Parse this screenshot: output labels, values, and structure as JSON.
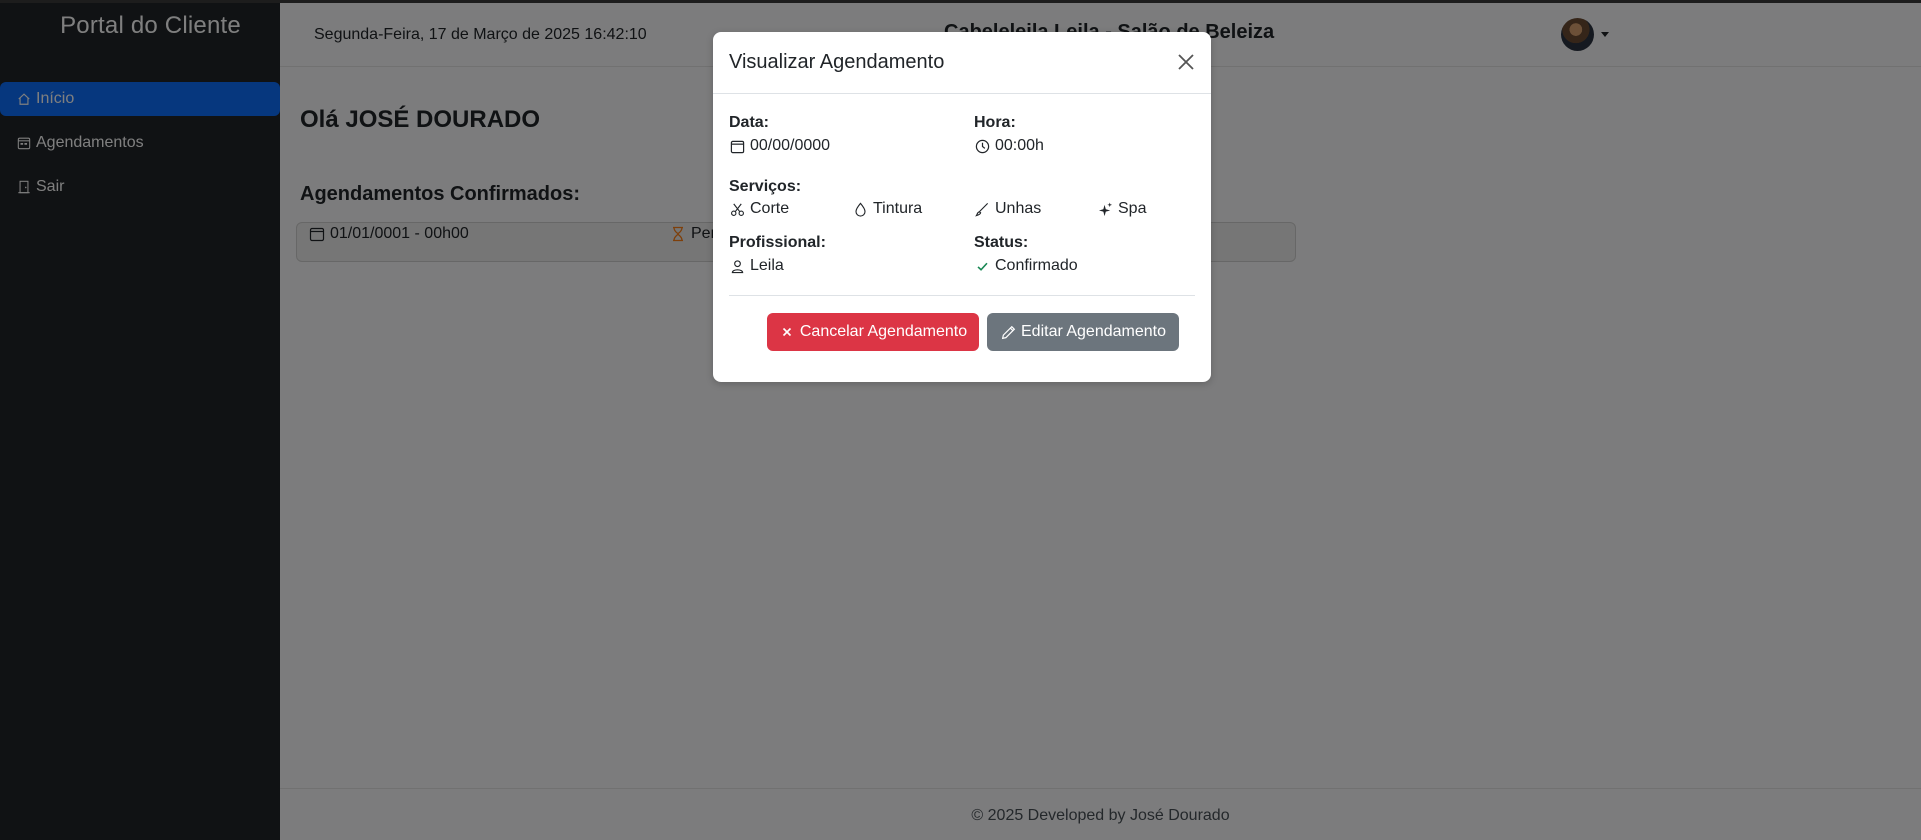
{
  "sidebar": {
    "brand": "Portal do Cliente",
    "items": [
      {
        "label": "Início",
        "icon": "house-icon",
        "active": true
      },
      {
        "label": "Agendamentos",
        "icon": "calendar-icon",
        "active": false
      },
      {
        "label": "Sair",
        "icon": "door-icon",
        "active": false
      }
    ]
  },
  "header": {
    "datetime": "Segunda-Feira, 17 de Março de 2025 16:42:10",
    "salon_name": "Cabeleleila Leila - Salão de Beleiza"
  },
  "main": {
    "greeting": "Olá JOSÉ DOURADO",
    "confirmed_title": "Agendamentos Confirmados:",
    "appointment": {
      "text": "01/01/0001 - 00h00",
      "status": "Pendente"
    }
  },
  "modal": {
    "title": "Visualizar Agendamento",
    "date_label": "Data:",
    "date_value": "00/00/0000",
    "time_label": "Hora:",
    "time_value": "00:00h",
    "services_label": "Serviços:",
    "services": [
      "Corte",
      "Tintura",
      "Unhas",
      "Spa"
    ],
    "professional_label": "Profissional:",
    "professional_value": "Leila",
    "status_label": "Status:",
    "status_value": "Confirmado",
    "cancel_label": "Cancelar Agendamento",
    "edit_label": "Editar Agendamento"
  },
  "footer": {
    "text": "© 2025 Developed by José Dourado"
  },
  "colors": {
    "sidebar_bg": "#212529",
    "active_nav": "#0d6efd",
    "danger": "#dc3545",
    "secondary": "#6c757d",
    "success": "#198754",
    "warning": "#fd7e14"
  }
}
